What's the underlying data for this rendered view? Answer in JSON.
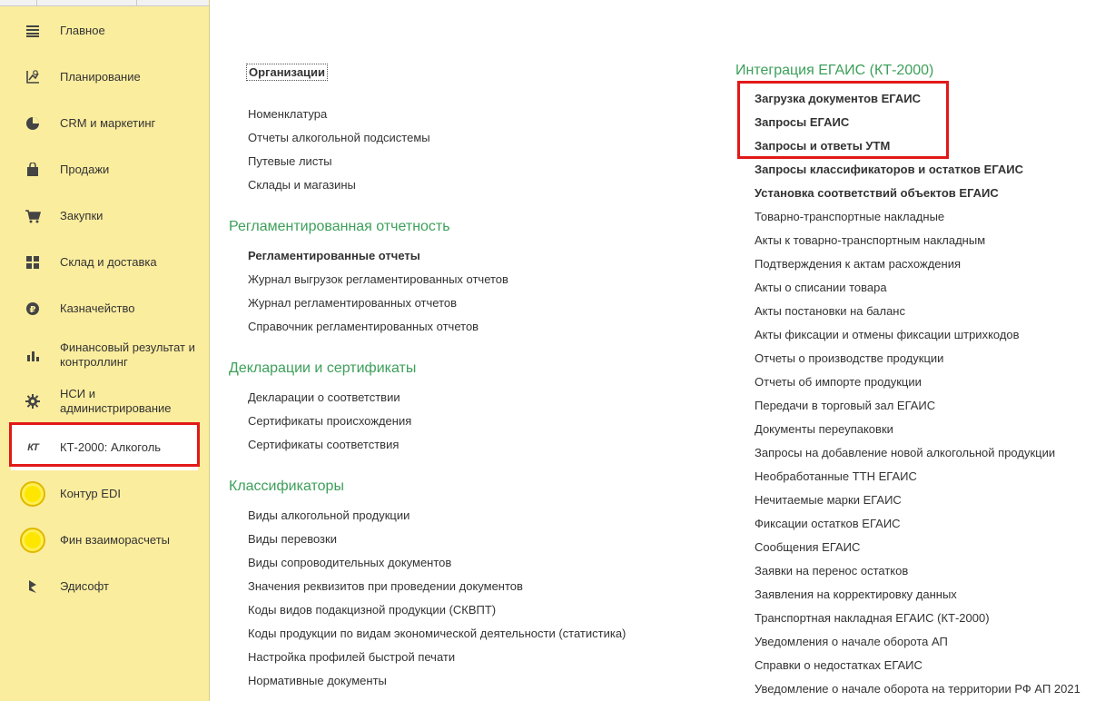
{
  "sidebar": {
    "items": [
      {
        "label": "Главное",
        "icon": "menu-lines-icon"
      },
      {
        "label": "Планирование",
        "icon": "planning-icon"
      },
      {
        "label": "CRM и маркетинг",
        "icon": "pie-chart-icon"
      },
      {
        "label": "Продажи",
        "icon": "shopping-bag-icon"
      },
      {
        "label": "Закупки",
        "icon": "cart-icon"
      },
      {
        "label": "Склад и доставка",
        "icon": "grid-icon"
      },
      {
        "label": "Казначейство",
        "icon": "ruble-coin-icon"
      },
      {
        "label": "Финансовый результат и контроллинг",
        "icon": "bar-chart-icon"
      },
      {
        "label": "НСИ и администрирование",
        "icon": "gear-icon"
      },
      {
        "label": "КТ-2000: Алкоголь",
        "icon": "kt-logo-icon"
      },
      {
        "label": "Контур EDI",
        "icon": "yellow-circle-icon"
      },
      {
        "label": "Фин взаиморасчеты",
        "icon": "yellow-circle-icon"
      },
      {
        "label": "Эдисофт",
        "icon": "edisoft-logo-icon"
      }
    ],
    "icon_glyphs": {
      "kt": "КТ"
    }
  },
  "left_column": {
    "org_link": "Организации",
    "group1": [
      "Номенклатура",
      "Отчеты алкогольной подсистемы",
      "Путевые листы",
      "Склады и магазины"
    ],
    "section_reg": {
      "title": "Регламентированная отчетность",
      "items": [
        "Регламентированные отчеты",
        "Журнал выгрузок регламентированных отчетов",
        "Журнал регламентированных отчетов",
        "Справочник регламентированных отчетов"
      ]
    },
    "section_decl": {
      "title": "Декларации и сертификаты",
      "items": [
        "Декларации о соответствии",
        "Сертификаты происхождения",
        "Сертификаты соответствия"
      ]
    },
    "section_class": {
      "title": "Классификаторы",
      "items": [
        "Виды алкогольной продукции",
        "Виды перевозки",
        "Виды сопроводительных документов",
        "Значения реквизитов при проведении документов",
        "Коды видов подакцизной продукции (СКВПТ)",
        "Коды продукции по видам экономической деятельности (статистика)",
        "Настройка профилей быстрой печати",
        "Нормативные документы"
      ]
    }
  },
  "right_column": {
    "title": "Интеграция ЕГАИС (КТ-2000)",
    "items": [
      "Загрузка документов ЕГАИС",
      "Запросы ЕГАИС",
      "Запросы и ответы УТМ",
      "Запросы классификаторов и остатков ЕГАИС",
      "Установка соответствий объектов ЕГАИС",
      "Товарно-транспортные накладные",
      "Акты к товарно-транспортным накладным",
      "Подтверждения к актам расхождения",
      "Акты о списании товара",
      "Акты постановки на баланс",
      "Акты фиксации и отмены фиксации штрихкодов",
      "Отчеты о производстве продукции",
      "Отчеты об импорте продукции",
      "Передачи в торговый зал ЕГАИС",
      "Документы переупаковки",
      "Запросы на добавление новой алкогольной продукции",
      "Необработанные ТТН ЕГАИС",
      "Нечитаемые марки ЕГАИС",
      "Фиксации остатков ЕГАИС",
      "Сообщения ЕГАИС",
      "Заявки на перенос остатков",
      "Заявления на корректировку данных",
      "Транспортная накладная ЕГАИС (КТ-2000)",
      "Уведомления о начале оборота АП",
      "Справки о недостатках ЕГАИС",
      "Уведомление о начале оборота на территории РФ АП 2021"
    ]
  },
  "colors": {
    "sidebar_bg": "#fbed9e",
    "section_title": "#3da05a",
    "highlight": "#e21818"
  }
}
